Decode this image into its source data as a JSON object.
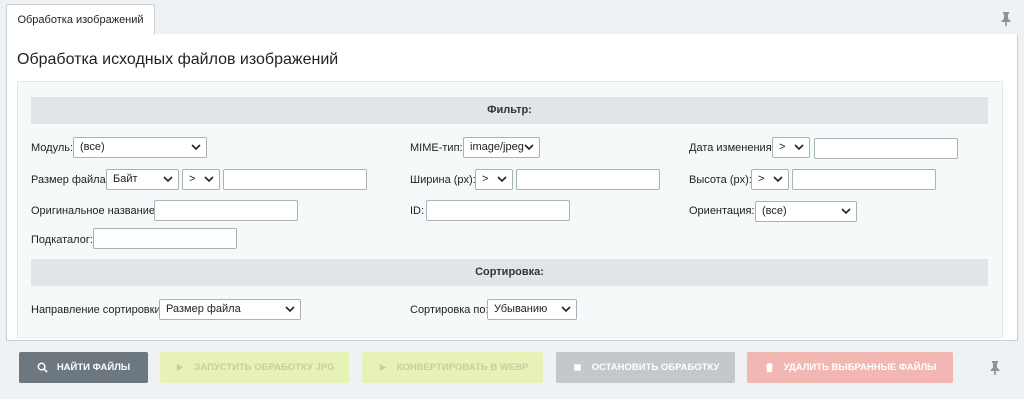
{
  "tab": {
    "label": "Обработка изображений"
  },
  "page": {
    "title": "Обработка исходных файлов изображений"
  },
  "filter": {
    "heading": "Фильтр:",
    "module": {
      "label": "Модуль:",
      "value": "(все)"
    },
    "mime": {
      "label": "MIME-тип:",
      "value": "image/jpeg"
    },
    "date_changed": {
      "label": "Дата изменения:",
      "operator": ">",
      "value": ""
    },
    "file_size": {
      "label": "Размер файла:",
      "unit": "Байт",
      "operator": ">",
      "value": ""
    },
    "width": {
      "label": "Ширина (px):",
      "operator": ">",
      "value": ""
    },
    "height": {
      "label": "Высота (px):",
      "operator": ">",
      "value": ""
    },
    "original_name": {
      "label": "Оригинальное название:",
      "value": ""
    },
    "id": {
      "label": "ID:",
      "value": ""
    },
    "orientation": {
      "label": "Ориентация:",
      "value": "(все)"
    },
    "subdir": {
      "label": "Подкаталог:",
      "value": ""
    }
  },
  "sorting": {
    "heading": "Сортировка:",
    "direction": {
      "label": "Направление сортировки:",
      "value": "Размер файла"
    },
    "order": {
      "label": "Сортировка по:",
      "value": "Убыванию"
    }
  },
  "buttons": {
    "find": "Найти файлы",
    "process_jpg": "Запустить обработку JPG",
    "convert_webp": "Конвертировать в WEBP",
    "stop": "Остановить обработку",
    "delete": "Удалить выбранные файлы"
  },
  "colors": {
    "find_bg": "#6d7780",
    "process_bg": "#e7f2b6",
    "stop_bg": "#c3c8cb",
    "delete_bg": "#f2b7b3"
  }
}
